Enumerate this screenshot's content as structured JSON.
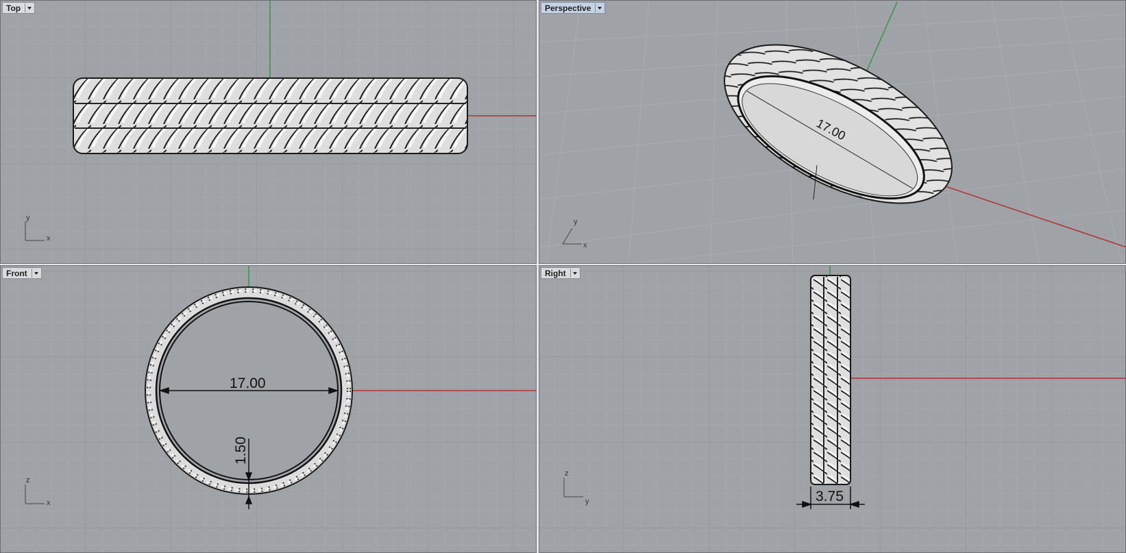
{
  "viewports": {
    "top": {
      "label": "Top",
      "axes": [
        "x",
        "y"
      ]
    },
    "perspective": {
      "label": "Perspective",
      "axes": [
        "x",
        "y"
      ]
    },
    "front": {
      "label": "Front",
      "axes": [
        "x",
        "z"
      ]
    },
    "right": {
      "label": "Right",
      "axes": [
        "y",
        "z"
      ]
    }
  },
  "dimensions": {
    "inner_diameter": "17.00",
    "thickness": "1.50",
    "width": "3.75"
  },
  "colors": {
    "viewport_bg": "#9fa3a8",
    "grid_minor": "#a9adb2",
    "grid_major": "#8d9196",
    "x_axis": "#b5332c",
    "y_axis": "#2f9a3a",
    "ring_fill": "#dcdcdc",
    "ring_stroke": "#1a1a1a"
  }
}
